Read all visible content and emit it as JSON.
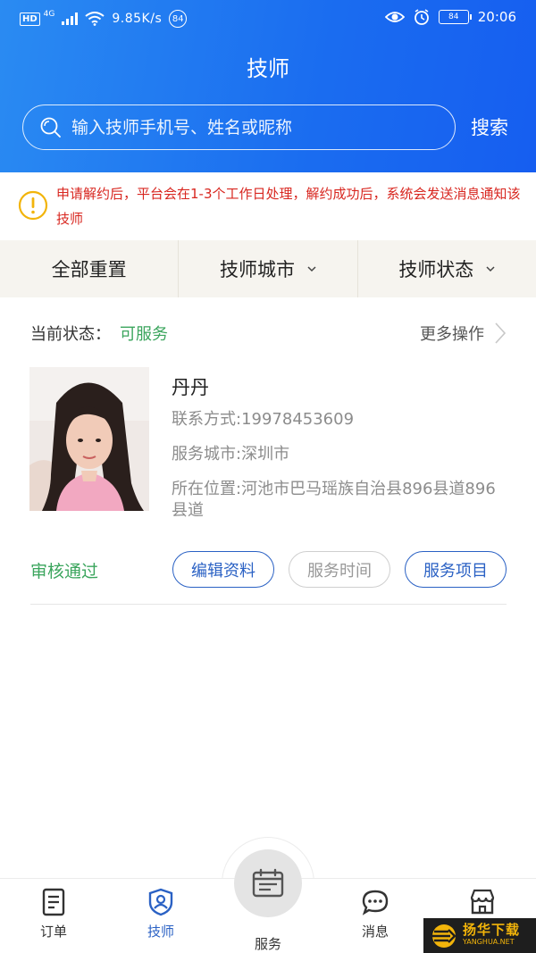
{
  "status_bar": {
    "hd": "HD",
    "network": "4G",
    "speed": "9.85K/s",
    "badge": "84",
    "battery": "84",
    "time": "20:06"
  },
  "header": {
    "title": "技师",
    "search_placeholder": "输入技师手机号、姓名或昵称",
    "search_button": "搜索"
  },
  "notice": {
    "text": "申请解约后，平台会在1-3个工作日处理，解约成功后，系统会发送消息通知该技师"
  },
  "filters": {
    "reset": "全部重置",
    "city": "技师城市",
    "status": "技师状态"
  },
  "card": {
    "status_label": "当前状态：",
    "status_value": "可服务",
    "more_ops": "更多操作",
    "name": "丹丹",
    "contact": "联系方式:19978453609",
    "service_city": "服务城市:深圳市",
    "location": "所在位置:河池市巴马瑶族自治县896县道896县道",
    "audit_status": "审核通过",
    "buttons": {
      "edit": "编辑资料",
      "service_time": "服务时间",
      "service_items": "服务项目"
    }
  },
  "bottom_nav": {
    "orders": "订单",
    "technician": "技师",
    "service": "服务",
    "messages": "消息",
    "shop_icon": "store-icon"
  },
  "watermark": {
    "cn": "扬华下载",
    "en": "YANGHUA.NET"
  },
  "colors": {
    "header_blue": "#1a6cf0",
    "notice_red": "#d8261f",
    "status_green": "#3ba55d",
    "accent_blue": "#2a61c4"
  }
}
